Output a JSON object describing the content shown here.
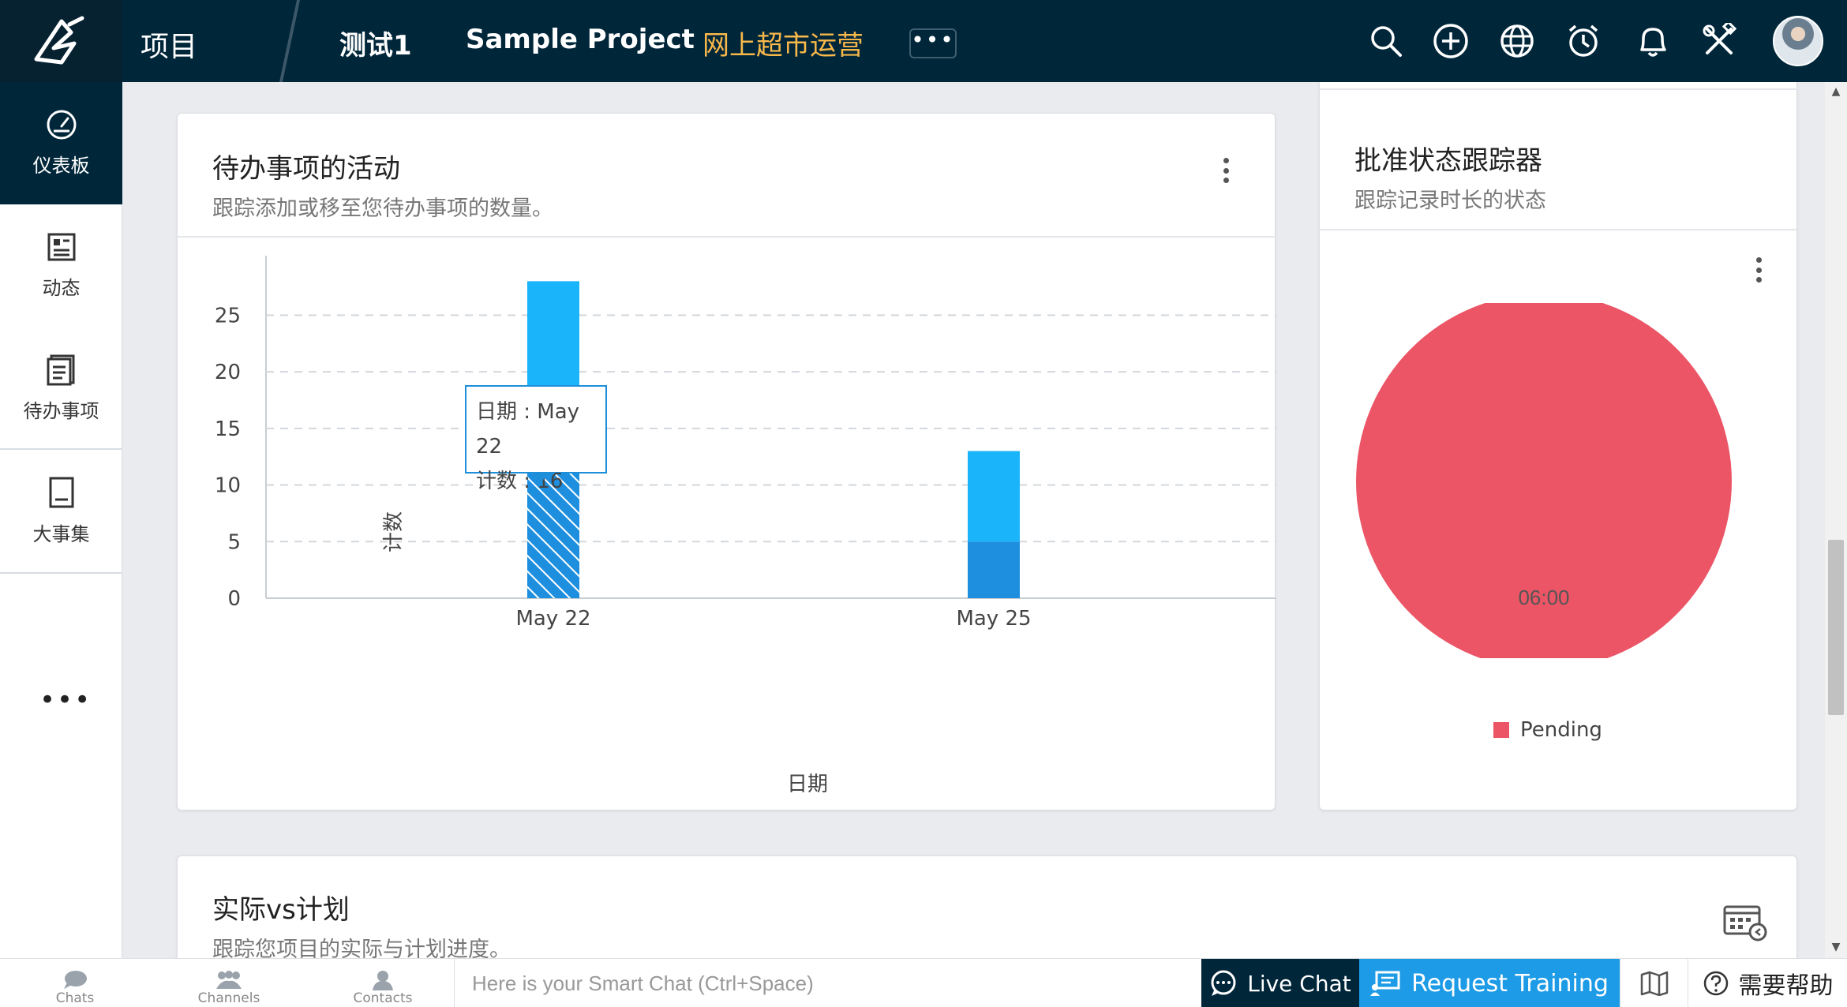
{
  "header": {
    "title": "项目",
    "tabs": [
      {
        "label": "测试1",
        "active": false
      },
      {
        "label": "Sample Project",
        "active": false
      },
      {
        "label": "网上超市运营",
        "active": true
      }
    ],
    "more_label": "•••",
    "icons": [
      "search-icon",
      "add-circle-icon",
      "globe-icon",
      "alarm-clock-icon",
      "bell-icon",
      "tools-icon"
    ]
  },
  "sidebar": {
    "items": [
      {
        "label": "仪表板",
        "icon": "dashboard-gauge-icon",
        "active": true
      },
      {
        "label": "动态",
        "icon": "feed-icon",
        "active": false
      },
      {
        "label": "待办事项",
        "icon": "todo-icon",
        "active": false
      },
      {
        "label": "大事集",
        "icon": "book-icon",
        "active": false
      }
    ],
    "more_label": "•••"
  },
  "todo_card": {
    "title": "待办事项的活动",
    "subtitle": "跟踪添加或移至您待办事项的数量。",
    "tooltip": {
      "line1": "日期 : May 22",
      "line2": "计数 : 16"
    }
  },
  "approval_card": {
    "title": "批准状态跟踪器",
    "subtitle": "跟踪记录时长的状态",
    "pie_label": "06:00",
    "legend": "Pending",
    "color": "#eb5566"
  },
  "actual_card": {
    "title": "实际vs计划",
    "subtitle": "跟踪您项目的实际与计划进度。"
  },
  "chart_data": [
    {
      "type": "bar",
      "title": "",
      "xlabel": "日期",
      "ylabel": "计数",
      "categories": [
        "May 22",
        "May 25"
      ],
      "series": [
        {
          "values": [
            16,
            5
          ],
          "colors": [
            "#1e8fde",
            "#1e8fde"
          ],
          "pattern": [
            "hatched",
            "solid"
          ]
        },
        {
          "values": [
            12,
            8
          ],
          "colors": [
            "#1ab4fa",
            "#1ab4fa"
          ]
        }
      ],
      "stacked": true,
      "ylim": [
        0,
        29
      ],
      "yticks": [
        0,
        5,
        10,
        15,
        20,
        25
      ],
      "grid": true
    },
    {
      "type": "pie",
      "slices": [
        {
          "label": "Pending",
          "value_text": "06:00",
          "fraction": 1.0,
          "color": "#eb5566"
        }
      ],
      "legend_position": "bottom"
    }
  ],
  "bottombar": {
    "tabs": [
      {
        "label": "Chats",
        "icon": "chat-bubble-icon"
      },
      {
        "label": "Channels",
        "icon": "channels-icon"
      },
      {
        "label": "Contacts",
        "icon": "contact-icon"
      }
    ],
    "input_placeholder": "Here is your Smart Chat (Ctrl+Space)",
    "live_chat": "Live Chat",
    "request_training": "Request Training",
    "help": "需要帮助"
  }
}
